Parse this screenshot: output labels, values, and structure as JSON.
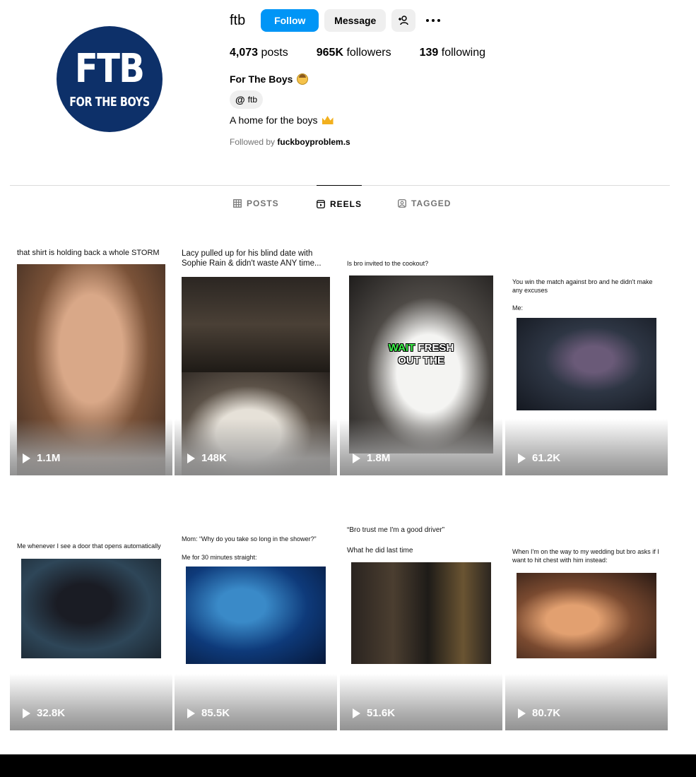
{
  "profile": {
    "username": "ftb",
    "avatar_text_big": "FTB",
    "avatar_text_small": "FOR THE BOYS",
    "follow_label": "Follow",
    "message_label": "Message",
    "posts_count": "4,073",
    "posts_label": "posts",
    "followers_count": "965K",
    "followers_label": "followers",
    "following_count": "139",
    "following_label": "following",
    "full_name": "For The Boys",
    "threads_handle": "ftb",
    "bio": "A home for the boys",
    "followed_by_prefix": "Followed by",
    "followed_by_user": "fuckboyproblem.s",
    "brand_color": "#0095f6",
    "avatar_color": "#0d3069"
  },
  "tabs": [
    {
      "label": "POSTS",
      "icon": "grid-icon",
      "active": false
    },
    {
      "label": "REELS",
      "icon": "reels-icon",
      "active": true
    },
    {
      "label": "TAGGED",
      "icon": "tagged-icon",
      "active": false
    }
  ],
  "reels": [
    {
      "caption": "that shirt is holding back a whole STORM",
      "views": "1.1M"
    },
    {
      "caption": "Lacy pulled up for his blind date with Sophie Rain & didn't waste ANY time...",
      "views": "148K"
    },
    {
      "caption": "Is bro invited to the cookout?",
      "overlay_green": "WAIT",
      "overlay_white": "FRESH",
      "overlay_line2": "OUT THE",
      "views": "1.8M"
    },
    {
      "caption": "You win the match against bro and he didn't make any excuses",
      "caption2": "Me:",
      "views": "61.2K"
    },
    {
      "caption": "Me whenever I see a door that opens automatically",
      "views": "32.8K"
    },
    {
      "caption": "Mom: “Why do you take so long in the shower?”",
      "caption2": "Me for 30 minutes straight:",
      "views": "85.5K"
    },
    {
      "caption": "“Bro trust me I'm a good driver”",
      "caption2": "What he did last time",
      "views": "51.6K"
    },
    {
      "caption": "When I'm on the way to my wedding but bro asks if I want to hit chest with him instead:",
      "views": "80.7K"
    }
  ]
}
